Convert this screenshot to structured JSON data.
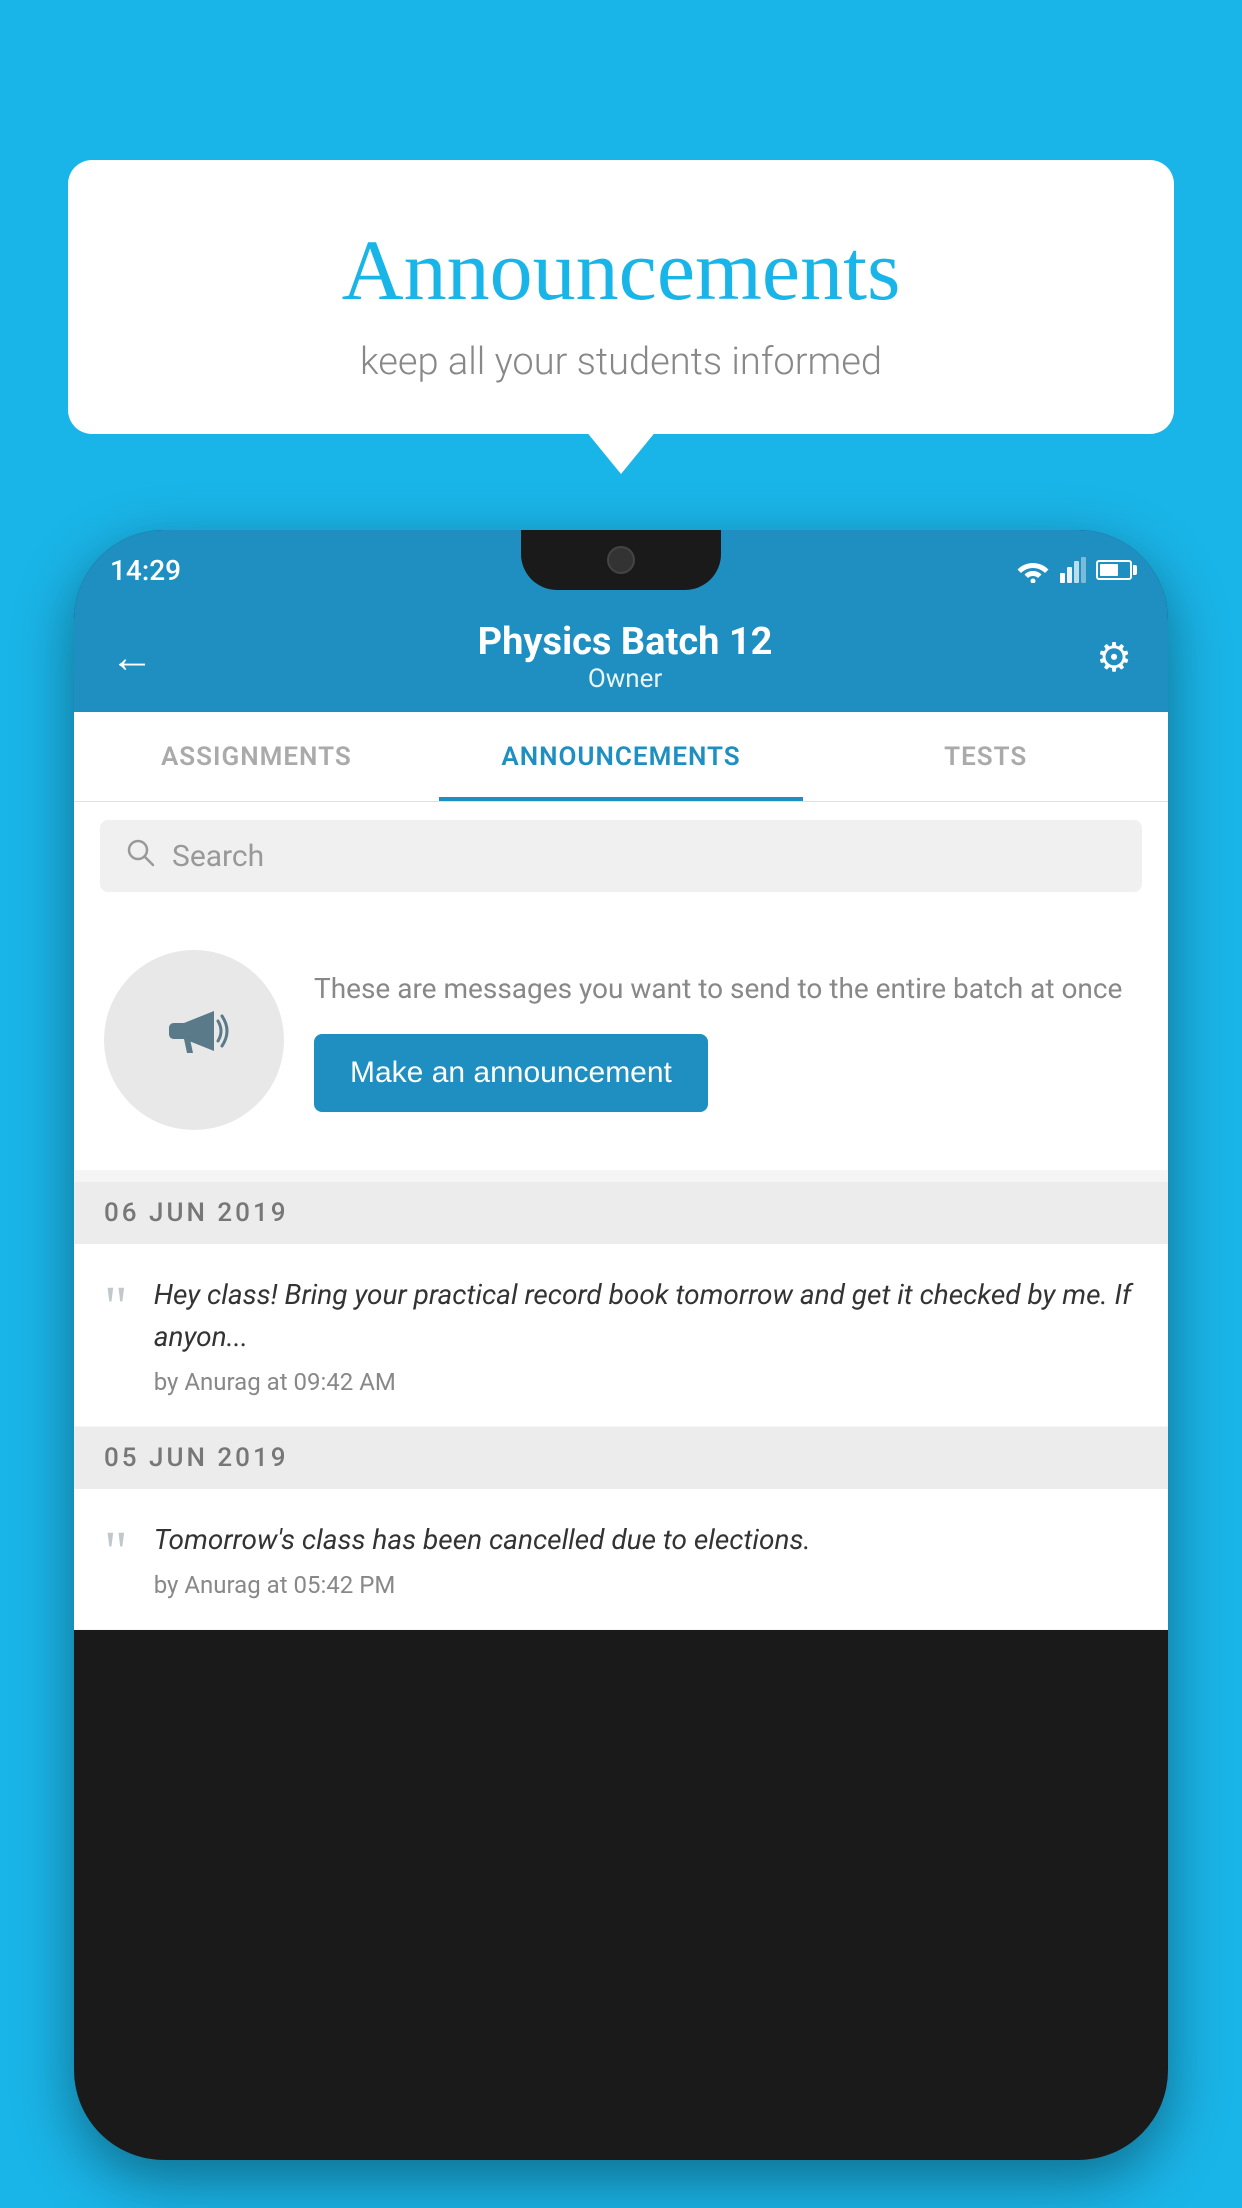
{
  "background_color": "#1ab5e8",
  "speech_bubble": {
    "title": "Announcements",
    "subtitle": "keep all your students informed"
  },
  "phone": {
    "status_bar": {
      "time": "14:29"
    },
    "app_bar": {
      "title": "Physics Batch 12",
      "subtitle": "Owner",
      "back_label": "←",
      "settings_label": "⚙"
    },
    "tabs": [
      {
        "label": "ASSIGNMENTS",
        "active": false
      },
      {
        "label": "ANNOUNCEMENTS",
        "active": true
      },
      {
        "label": "TESTS",
        "active": false
      }
    ],
    "search": {
      "placeholder": "Search"
    },
    "promo": {
      "description": "These are messages you want to send to the entire batch at once",
      "button_label": "Make an announcement"
    },
    "announcements": [
      {
        "date": "06  JUN  2019",
        "text": "Hey class! Bring your practical record book tomorrow and get it checked by me. If anyon...",
        "meta": "by Anurag at 09:42 AM"
      },
      {
        "date": "05  JUN  2019",
        "text": "Tomorrow's class has been cancelled due to elections.",
        "meta": "by Anurag at 05:42 PM"
      }
    ]
  }
}
